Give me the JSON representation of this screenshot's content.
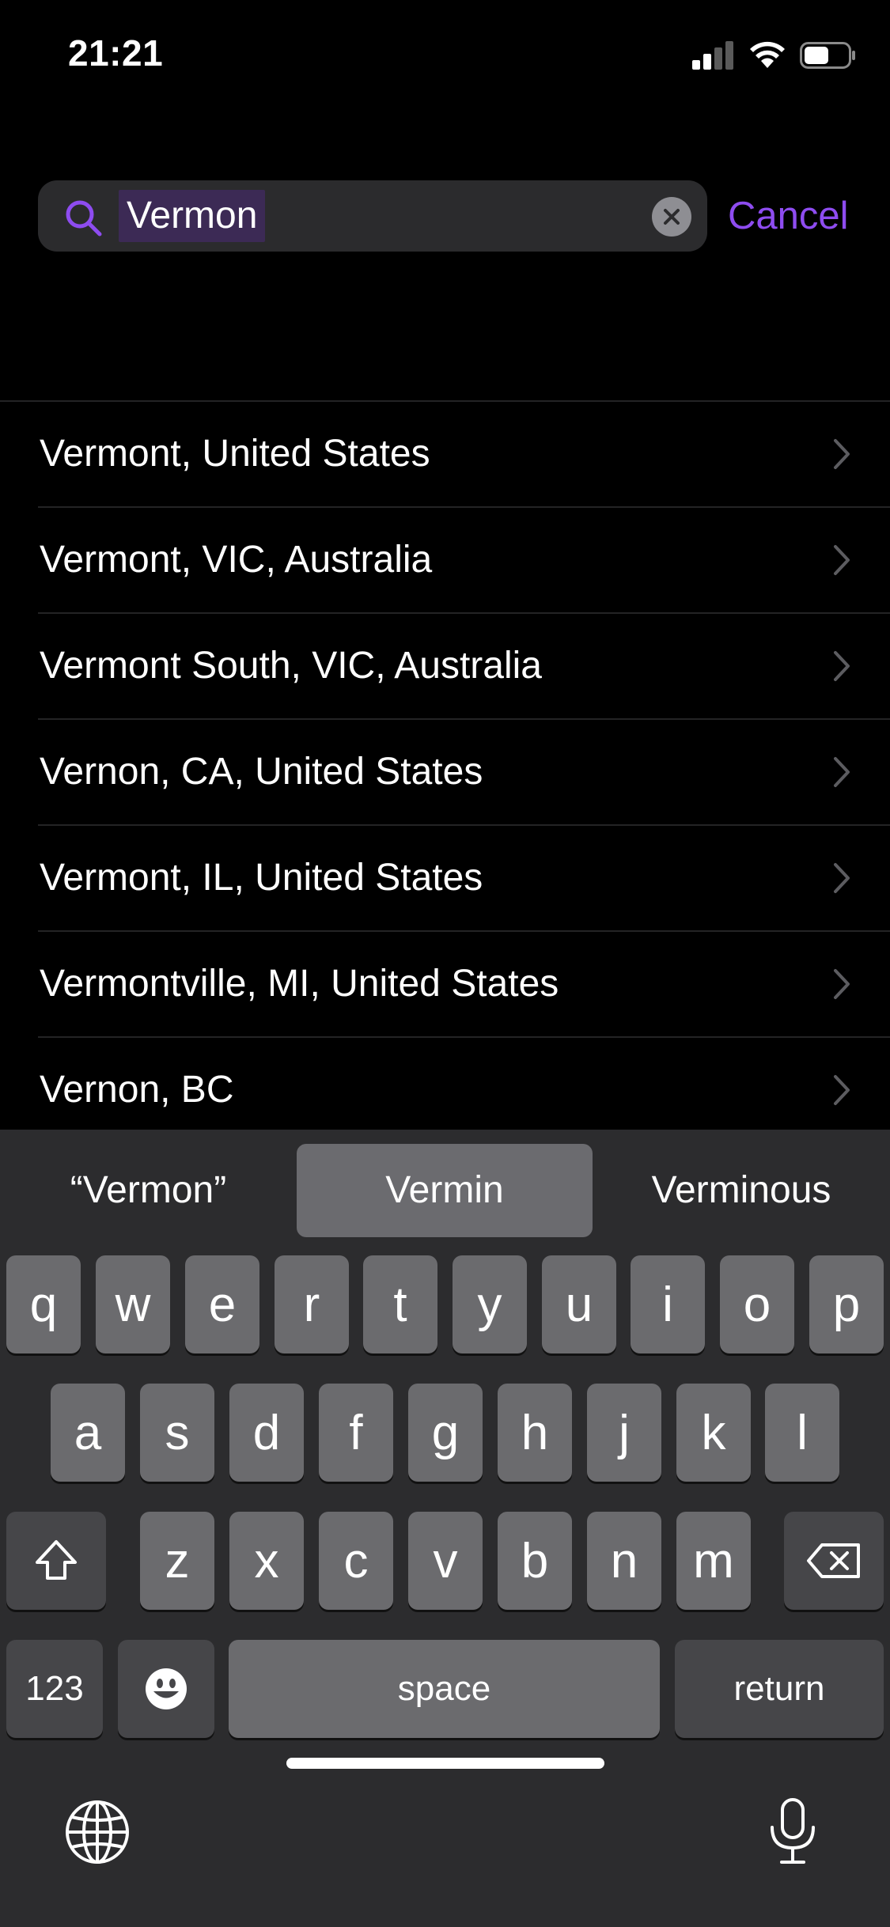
{
  "status_bar": {
    "time": "21:21"
  },
  "search": {
    "query": "Vermon",
    "cancel_label": "Cancel",
    "accent_color": "#8e4cf0"
  },
  "results": [
    {
      "label": "Vermont, United States"
    },
    {
      "label": "Vermont, VIC, Australia"
    },
    {
      "label": "Vermont South, VIC, Australia"
    },
    {
      "label": "Vernon, CA, United States"
    },
    {
      "label": "Vermont, IL, United States"
    },
    {
      "label": "Vermontville, MI, United States"
    },
    {
      "label": "Vernon, BC"
    }
  ],
  "keyboard": {
    "suggestions": [
      "“Vermon”",
      "Vermin",
      "Verminous"
    ],
    "row1": [
      "q",
      "w",
      "e",
      "r",
      "t",
      "y",
      "u",
      "i",
      "o",
      "p"
    ],
    "row2": [
      "a",
      "s",
      "d",
      "f",
      "g",
      "h",
      "j",
      "k",
      "l"
    ],
    "row3": [
      "z",
      "x",
      "c",
      "v",
      "b",
      "n",
      "m"
    ],
    "numbers_label": "123",
    "space_label": "space",
    "return_label": "return"
  }
}
